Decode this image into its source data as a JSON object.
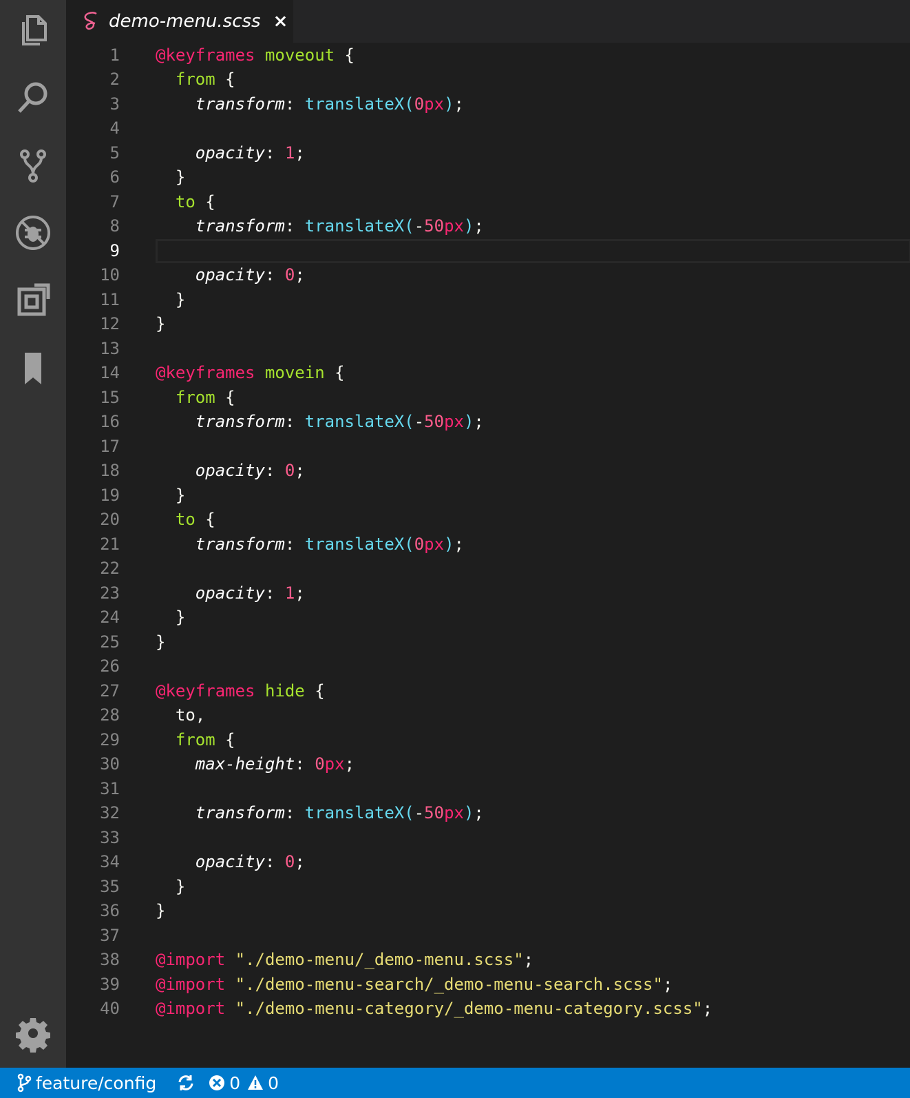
{
  "activity_bar": {
    "icons": [
      "files-icon",
      "search-icon",
      "source-control-icon",
      "debug-icon",
      "extensions-icon",
      "bookmark-icon"
    ],
    "settings_icon": "gear-icon"
  },
  "tab": {
    "title": "demo-menu.scss",
    "close": "×",
    "lang_icon": "sass-icon",
    "lang_color": "#f06292"
  },
  "editor": {
    "active_line": 9,
    "lines": [
      [
        [
          "at",
          "@keyframes"
        ],
        [
          "p",
          " "
        ],
        [
          "name",
          "moveout"
        ],
        [
          "p",
          " {"
        ]
      ],
      [
        [
          "p",
          "  "
        ],
        [
          "key",
          "from"
        ],
        [
          "p",
          " {"
        ]
      ],
      [
        [
          "p",
          "    "
        ],
        [
          "prop",
          "transform"
        ],
        [
          "p",
          ": "
        ],
        [
          "fn",
          "translateX("
        ],
        [
          "num",
          "0"
        ],
        [
          "unit",
          "px"
        ],
        [
          "fn",
          ")"
        ],
        [
          "p",
          ";"
        ]
      ],
      [],
      [
        [
          "p",
          "    "
        ],
        [
          "prop",
          "opacity"
        ],
        [
          "p",
          ": "
        ],
        [
          "num",
          "1"
        ],
        [
          "p",
          ";"
        ]
      ],
      [
        [
          "p",
          "  }"
        ]
      ],
      [
        [
          "p",
          "  "
        ],
        [
          "key",
          "to"
        ],
        [
          "p",
          " {"
        ]
      ],
      [
        [
          "p",
          "    "
        ],
        [
          "prop",
          "transform"
        ],
        [
          "p",
          ": "
        ],
        [
          "fn",
          "translateX("
        ],
        [
          "p",
          "-"
        ],
        [
          "num",
          "50"
        ],
        [
          "unit",
          "px"
        ],
        [
          "fn",
          ")"
        ],
        [
          "p",
          ";"
        ]
      ],
      [],
      [
        [
          "p",
          "    "
        ],
        [
          "prop",
          "opacity"
        ],
        [
          "p",
          ": "
        ],
        [
          "num",
          "0"
        ],
        [
          "p",
          ";"
        ]
      ],
      [
        [
          "p",
          "  }"
        ]
      ],
      [
        [
          "p",
          "}"
        ]
      ],
      [],
      [
        [
          "at",
          "@keyframes"
        ],
        [
          "p",
          " "
        ],
        [
          "name",
          "movein"
        ],
        [
          "p",
          " {"
        ]
      ],
      [
        [
          "p",
          "  "
        ],
        [
          "key",
          "from"
        ],
        [
          "p",
          " {"
        ]
      ],
      [
        [
          "p",
          "    "
        ],
        [
          "prop",
          "transform"
        ],
        [
          "p",
          ": "
        ],
        [
          "fn",
          "translateX("
        ],
        [
          "p",
          "-"
        ],
        [
          "num",
          "50"
        ],
        [
          "unit",
          "px"
        ],
        [
          "fn",
          ")"
        ],
        [
          "p",
          ";"
        ]
      ],
      [],
      [
        [
          "p",
          "    "
        ],
        [
          "prop",
          "opacity"
        ],
        [
          "p",
          ": "
        ],
        [
          "num",
          "0"
        ],
        [
          "p",
          ";"
        ]
      ],
      [
        [
          "p",
          "  }"
        ]
      ],
      [
        [
          "p",
          "  "
        ],
        [
          "key",
          "to"
        ],
        [
          "p",
          " {"
        ]
      ],
      [
        [
          "p",
          "    "
        ],
        [
          "prop",
          "transform"
        ],
        [
          "p",
          ": "
        ],
        [
          "fn",
          "translateX("
        ],
        [
          "num",
          "0"
        ],
        [
          "unit",
          "px"
        ],
        [
          "fn",
          ")"
        ],
        [
          "p",
          ";"
        ]
      ],
      [],
      [
        [
          "p",
          "    "
        ],
        [
          "prop",
          "opacity"
        ],
        [
          "p",
          ": "
        ],
        [
          "num",
          "1"
        ],
        [
          "p",
          ";"
        ]
      ],
      [
        [
          "p",
          "  }"
        ]
      ],
      [
        [
          "p",
          "}"
        ]
      ],
      [],
      [
        [
          "at",
          "@keyframes"
        ],
        [
          "p",
          " "
        ],
        [
          "name",
          "hide"
        ],
        [
          "p",
          " {"
        ]
      ],
      [
        [
          "p",
          "  to,"
        ]
      ],
      [
        [
          "p",
          "  "
        ],
        [
          "key",
          "from"
        ],
        [
          "p",
          " {"
        ]
      ],
      [
        [
          "p",
          "    "
        ],
        [
          "prop",
          "max-height"
        ],
        [
          "p",
          ": "
        ],
        [
          "num",
          "0"
        ],
        [
          "unit",
          "px"
        ],
        [
          "p",
          ";"
        ]
      ],
      [],
      [
        [
          "p",
          "    "
        ],
        [
          "prop",
          "transform"
        ],
        [
          "p",
          ": "
        ],
        [
          "fn",
          "translateX("
        ],
        [
          "p",
          "-"
        ],
        [
          "num",
          "50"
        ],
        [
          "unit",
          "px"
        ],
        [
          "fn",
          ")"
        ],
        [
          "p",
          ";"
        ]
      ],
      [],
      [
        [
          "p",
          "    "
        ],
        [
          "prop",
          "opacity"
        ],
        [
          "p",
          ": "
        ],
        [
          "num",
          "0"
        ],
        [
          "p",
          ";"
        ]
      ],
      [
        [
          "p",
          "  }"
        ]
      ],
      [
        [
          "p",
          "}"
        ]
      ],
      [],
      [
        [
          "at",
          "@import"
        ],
        [
          "p",
          " "
        ],
        [
          "str",
          "\"./demo-menu/_demo-menu.scss\""
        ],
        [
          "p",
          ";"
        ]
      ],
      [
        [
          "at",
          "@import"
        ],
        [
          "p",
          " "
        ],
        [
          "str",
          "\"./demo-menu-search/_demo-menu-search.scss\""
        ],
        [
          "p",
          ";"
        ]
      ],
      [
        [
          "at",
          "@import"
        ],
        [
          "p",
          " "
        ],
        [
          "str",
          "\"./demo-menu-category/_demo-menu-category.scss\""
        ],
        [
          "p",
          ";"
        ]
      ]
    ]
  },
  "status_bar": {
    "branch": "feature/config",
    "errors": "0",
    "warnings": "0",
    "background": "#007acc"
  }
}
